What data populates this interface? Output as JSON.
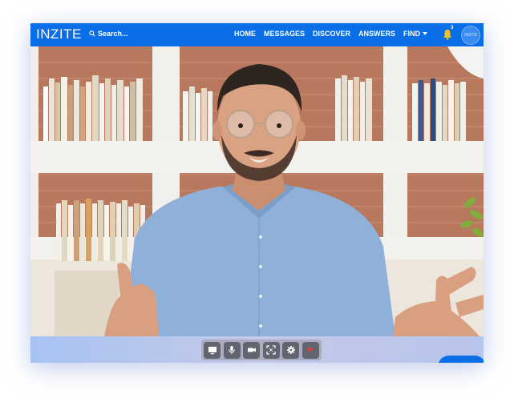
{
  "app": {
    "logo": "INZITE"
  },
  "search": {
    "label": "Search..."
  },
  "nav": {
    "items": [
      "HOME",
      "MESSAGES",
      "DISCOVER",
      "ANSWERS",
      "FIND"
    ]
  },
  "notifications": {
    "count": "3",
    "icon": "bell-icon"
  },
  "avatar": {
    "text": "INZITE"
  },
  "controls": {
    "buttons": [
      "screen-share-icon",
      "microphone-icon",
      "camera-icon",
      "fullscreen-icon",
      "settings-icon",
      "end-call-icon"
    ]
  },
  "colors": {
    "brand": "#0a6fe6",
    "control_button": "#62656f",
    "end_call": "#e53935"
  }
}
